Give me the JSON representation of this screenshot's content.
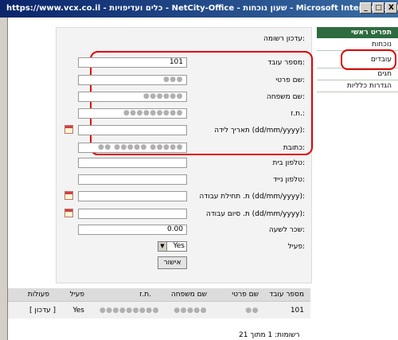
{
  "window": {
    "title": "https://www.vcx.co.il - כלים ועדיפויות - NetCity-Office - שעון נוכחות - Microsoft Internet Expl...",
    "min_label": "_",
    "max_label": "□",
    "close_label": "X"
  },
  "nav": {
    "items": [
      {
        "label": "תפריט ראשי"
      },
      {
        "label": "נוכחות"
      },
      {
        "label": "עובדים"
      },
      {
        "label": "חגים"
      },
      {
        "label": "הגדרות כלליות"
      }
    ]
  },
  "form": {
    "heading": "עדכון רשומה:",
    "fields": {
      "employee_no": {
        "label": "מספר עובד:",
        "value": "101"
      },
      "first_name": {
        "label": "שם פרטי:",
        "value": "●●●"
      },
      "last_name": {
        "label": "שם משפחה:",
        "value": "●●●●●●"
      },
      "id_no": {
        "label": "ת.ז.:",
        "value": "●●●●●●●●●"
      },
      "birth_date": {
        "label": "תאריך לידה (dd/mm/yyyy):",
        "value": ""
      },
      "address": {
        "label": "כתובת:",
        "value": "●● ●●●●● ●●●●● ●●●●"
      },
      "home_phone": {
        "label": "טלפון בית:",
        "value": ""
      },
      "mobile_phone": {
        "label": "טלפון נייד:",
        "value": ""
      },
      "start_date": {
        "label": "ת. תחילת עבודה (dd/mm/yyyy):",
        "value": ""
      },
      "end_date": {
        "label": "ת. סיום עבודה (dd/mm/yyyy):",
        "value": ""
      },
      "hourly_wage": {
        "label": "שכר לשעה:",
        "value": "0.00"
      },
      "active": {
        "label": "פעיל:",
        "value": "Yes"
      }
    },
    "submit_label": "אישור"
  },
  "table": {
    "headers": {
      "employee_no": "מספר עובד",
      "first_name": "שם פרטי",
      "last_name": "שם משפחה",
      "id_no": "ת.ז.",
      "active": "פעיל",
      "actions": "פעולות"
    },
    "rows": [
      {
        "employee_no": "101",
        "first_name": "●●",
        "last_name": "●●●●●",
        "id_no": "●●●●●●●●●",
        "active": "Yes",
        "action_label": "[ עדכון ]"
      }
    ]
  },
  "footer": {
    "records": "רשומות: 1 מתוך 21"
  },
  "colors": {
    "nav_header": "#2e6b3f",
    "highlight": "#e00000",
    "titlebar": "#0a246a"
  }
}
